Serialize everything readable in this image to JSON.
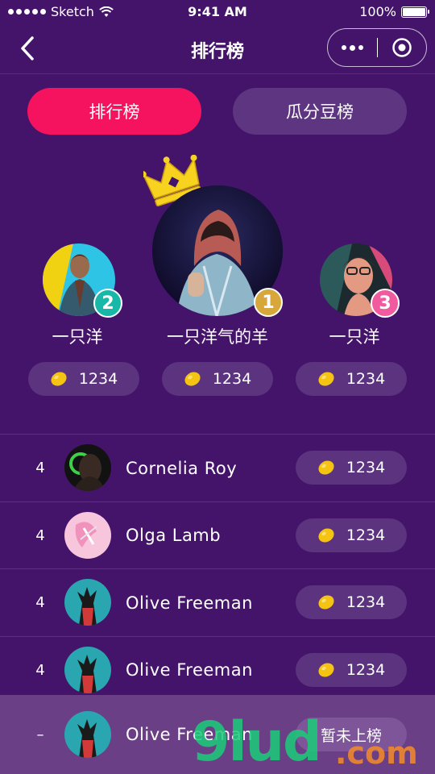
{
  "status_bar": {
    "carrier": "Sketch",
    "time": "9:41 AM",
    "battery": "100%"
  },
  "nav": {
    "title": "排行榜"
  },
  "tabs": [
    {
      "label": "排行榜",
      "active": true
    },
    {
      "label": "瓜分豆榜",
      "active": false
    }
  ],
  "podium": {
    "first": {
      "rank": "1",
      "name": "一只洋气的羊",
      "score": "1234"
    },
    "second": {
      "rank": "2",
      "name": "一只洋",
      "score": "1234"
    },
    "third": {
      "rank": "3",
      "name": "一只洋",
      "score": "1234"
    }
  },
  "list": [
    {
      "rank": "4",
      "name": "Cornelia Roy",
      "score": "1234"
    },
    {
      "rank": "4",
      "name": "Olga Lamb",
      "score": "1234"
    },
    {
      "rank": "4",
      "name": "Olive Freeman",
      "score": "1234"
    },
    {
      "rank": "4",
      "name": "Olive Freeman",
      "score": "1234"
    }
  ],
  "my_rank": {
    "rank": "–",
    "name": "Olive Freeman",
    "status": "暂未上榜"
  },
  "watermark": {
    "logo": "9lud",
    "domain": ".com"
  },
  "colors": {
    "background": "#44146a",
    "accent": "#f5125e",
    "pill": "#5c337f",
    "gold_badge": "#d8a73c",
    "silver_badge": "#17b8a8",
    "bronze_badge": "#f25aa0"
  }
}
